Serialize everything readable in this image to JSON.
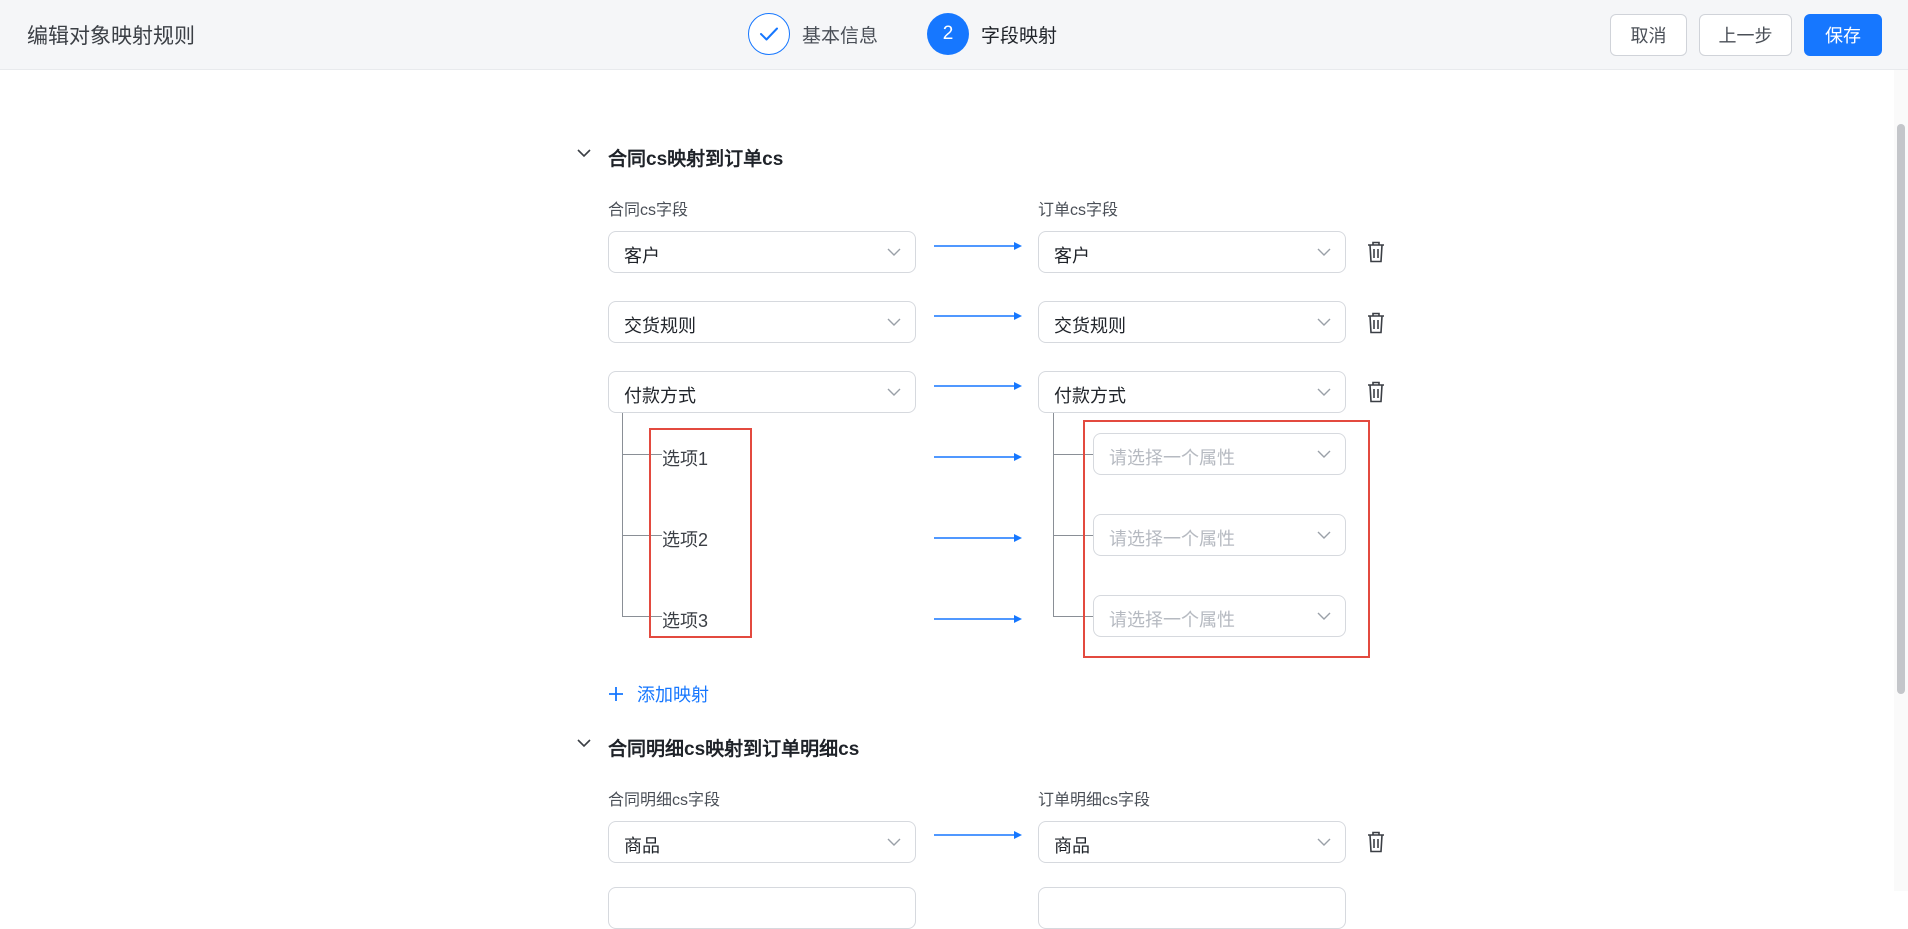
{
  "header": {
    "title": "编辑对象映射规则",
    "steps": [
      {
        "index": "",
        "label": "基本信息",
        "state": "done"
      },
      {
        "index": "2",
        "label": "字段映射",
        "state": "active"
      }
    ],
    "buttons": {
      "cancel": "取消",
      "prev": "上一步",
      "save": "保存"
    }
  },
  "sections": [
    {
      "title": "合同cs映射到订单cs",
      "source_header": "合同cs字段",
      "target_header": "订单cs字段",
      "rows": [
        {
          "source": "客户",
          "target": "客户"
        },
        {
          "source": "交货规则",
          "target": "交货规则"
        },
        {
          "source": "付款方式",
          "target": "付款方式"
        }
      ],
      "options": [
        {
          "source": "选项1",
          "target_placeholder": "请选择一个属性"
        },
        {
          "source": "选项2",
          "target_placeholder": "请选择一个属性"
        },
        {
          "source": "选项3",
          "target_placeholder": "请选择一个属性"
        }
      ],
      "add_label": "添加映射"
    },
    {
      "title": "合同明细cs映射到订单明细cs",
      "source_header": "合同明细cs字段",
      "target_header": "订单明细cs字段",
      "rows": [
        {
          "source": "商品",
          "target": "商品"
        }
      ]
    }
  ],
  "colors": {
    "accent": "#1677ff",
    "highlight": "#e34a3f"
  }
}
